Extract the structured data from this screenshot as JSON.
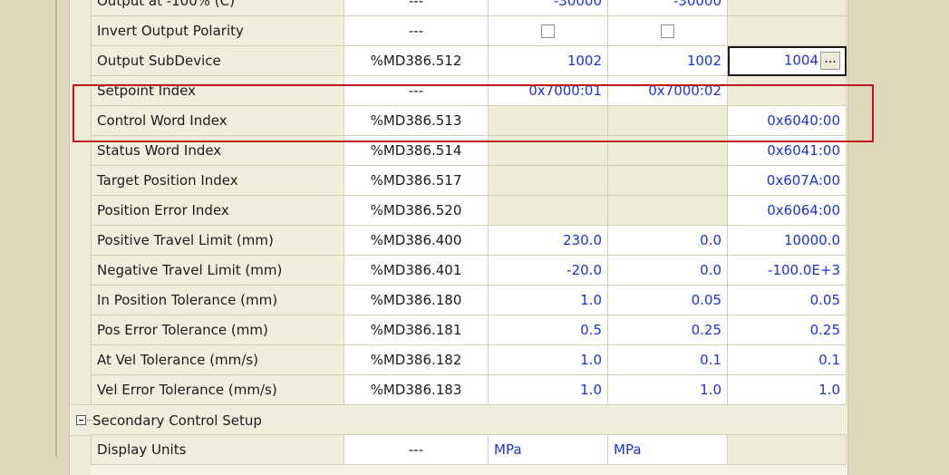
{
  "rows": [
    {
      "name": "Output at -100% (C)",
      "addr": "---",
      "v1": "-30000",
      "v2": "-30000",
      "v3": ""
    },
    {
      "name": "Invert Output Polarity",
      "addr": "---",
      "v1": "",
      "v2": "",
      "v3": ""
    },
    {
      "name": "Output SubDevice",
      "addr": "%MD386.512",
      "v1": "1002",
      "v2": "1002",
      "v3": "1004"
    },
    {
      "name": "Setpoint Index",
      "addr": "---",
      "v1": "0x7000:01",
      "v2": "0x7000:02",
      "v3": ""
    },
    {
      "name": "Control Word Index",
      "addr": "%MD386.513",
      "v1": "",
      "v2": "",
      "v3": "0x6040:00"
    },
    {
      "name": "Status Word Index",
      "addr": "%MD386.514",
      "v1": "",
      "v2": "",
      "v3": "0x6041:00"
    },
    {
      "name": "Target Position Index",
      "addr": "%MD386.517",
      "v1": "",
      "v2": "",
      "v3": "0x607A:00"
    },
    {
      "name": "Position Error Index",
      "addr": "%MD386.520",
      "v1": "",
      "v2": "",
      "v3": "0x6064:00"
    },
    {
      "name": "Positive Travel Limit (mm)",
      "addr": "%MD386.400",
      "v1": "230.0",
      "v2": "0.0",
      "v3": "10000.0"
    },
    {
      "name": "Negative Travel Limit (mm)",
      "addr": "%MD386.401",
      "v1": "-20.0",
      "v2": "0.0",
      "v3": "-100.0E+3"
    },
    {
      "name": "In Position Tolerance (mm)",
      "addr": "%MD386.180",
      "v1": "1.0",
      "v2": "0.05",
      "v3": "0.05"
    },
    {
      "name": "Pos Error Tolerance (mm)",
      "addr": "%MD386.181",
      "v1": "0.5",
      "v2": "0.25",
      "v3": "0.25"
    },
    {
      "name": "At Vel Tolerance (mm/s)",
      "addr": "%MD386.182",
      "v1": "1.0",
      "v2": "0.1",
      "v3": "0.1"
    },
    {
      "name": "Vel Error Tolerance (mm/s)",
      "addr": "%MD386.183",
      "v1": "1.0",
      "v2": "1.0",
      "v3": "1.0"
    }
  ],
  "section": {
    "label": "Secondary Control Setup"
  },
  "display_units": {
    "name": "Display Units",
    "addr": "---",
    "v1": "MPa",
    "v2": "MPa",
    "v3": ""
  },
  "ellipsis_label": "...",
  "colors": {
    "value_text": "#1b33d4",
    "highlight": "#c0141c"
  }
}
